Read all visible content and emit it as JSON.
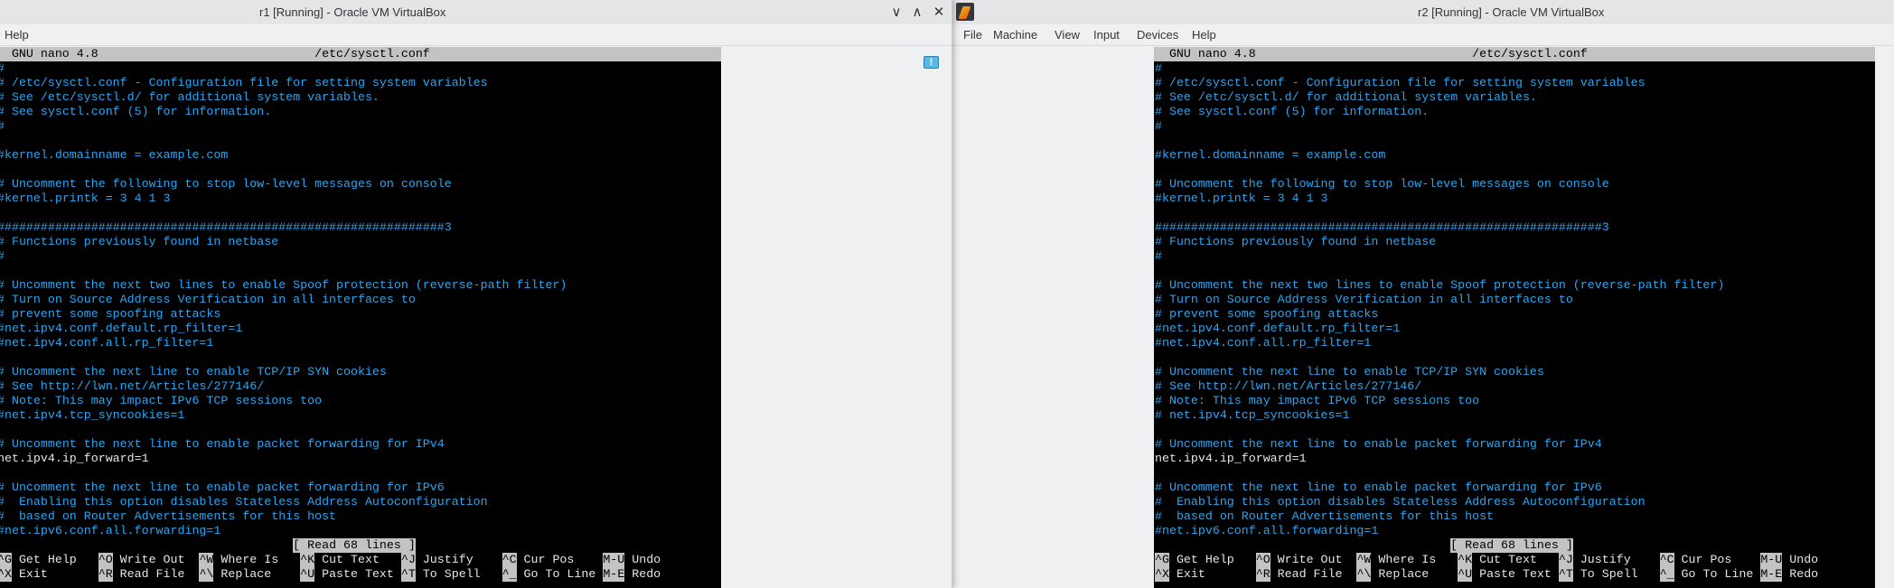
{
  "windows": [
    {
      "title": "r1 [Running] - Oracle VM VirtualBox",
      "menu": [
        "Help"
      ],
      "controls": {
        "minimize": "∨",
        "maximize": "∧",
        "close": "✕"
      },
      "nano": {
        "header_left": "GNU nano 4.8",
        "header_file": "/etc/sysctl.conf",
        "lines": [
          "#",
          "# /etc/sysctl.conf - Configuration file for setting system variables",
          "# See /etc/sysctl.d/ for additional system variables.",
          "# See sysctl.conf (5) for information.",
          "#",
          "",
          "#kernel.domainname = example.com",
          "",
          "# Uncomment the following to stop low-level messages on console",
          "#kernel.printk = 3 4 1 3",
          "",
          "##############################################################3",
          "# Functions previously found in netbase",
          "#",
          "",
          "# Uncomment the next two lines to enable Spoof protection (reverse-path filter)",
          "# Turn on Source Address Verification in all interfaces to",
          "# prevent some spoofing attacks",
          "#net.ipv4.conf.default.rp_filter=1",
          "#net.ipv4.conf.all.rp_filter=1",
          "",
          "# Uncomment the next line to enable TCP/IP SYN cookies",
          "# See http://lwn.net/Articles/277146/",
          "# Note: This may impact IPv6 TCP sessions too",
          "#net.ipv4.tcp_syncookies=1",
          "",
          "# Uncomment the next line to enable packet forwarding for IPv4",
          "net.ipv4.ip_forward=1",
          "",
          "# Uncomment the next line to enable packet forwarding for IPv6",
          "#  Enabling this option disables Stateless Address Autoconfiguration",
          "#  based on Router Advertisements for this host",
          "#net.ipv6.conf.all.forwarding=1"
        ],
        "status": "[ Read 68 lines ]",
        "shortcuts": [
          [
            {
              "key": "^G",
              "label": "Get Help"
            },
            {
              "key": "^O",
              "label": "Write Out"
            },
            {
              "key": "^W",
              "label": "Where Is"
            },
            {
              "key": "^K",
              "label": "Cut Text"
            },
            {
              "key": "^J",
              "label": "Justify"
            },
            {
              "key": "^C",
              "label": "Cur Pos"
            },
            {
              "key": "M-U",
              "label": "Undo"
            }
          ],
          [
            {
              "key": "^X",
              "label": "Exit"
            },
            {
              "key": "^R",
              "label": "Read File"
            },
            {
              "key": "^\\",
              "label": "Replace"
            },
            {
              "key": "^U",
              "label": "Paste Text"
            },
            {
              "key": "^T",
              "label": "To Spell"
            },
            {
              "key": "^_",
              "label": "Go To Line"
            },
            {
              "key": "M-E",
              "label": "Redo"
            }
          ]
        ]
      }
    },
    {
      "title": "r2 [Running] - Oracle VM VirtualBox",
      "menu": [
        "File",
        "Machine",
        "View",
        "Input",
        "Devices",
        "Help"
      ],
      "nano": {
        "header_left": "GNU nano 4.8",
        "header_file": "/etc/sysctl.conf",
        "lines": [
          "#",
          "# /etc/sysctl.conf - Configuration file for setting system variables",
          "# See /etc/sysctl.d/ for additional system variables.",
          "# See sysctl.conf (5) for information.",
          "#",
          "",
          "#kernel.domainname = example.com",
          "",
          "# Uncomment the following to stop low-level messages on console",
          "#kernel.printk = 3 4 1 3",
          "",
          "##############################################################3",
          "# Functions previously found in netbase",
          "#",
          "",
          "# Uncomment the next two lines to enable Spoof protection (reverse-path filter)",
          "# Turn on Source Address Verification in all interfaces to",
          "# prevent some spoofing attacks",
          "#net.ipv4.conf.default.rp_filter=1",
          "#net.ipv4.conf.all.rp_filter=1",
          "",
          "# Uncomment the next line to enable TCP/IP SYN cookies",
          "# See http://lwn.net/Articles/277146/",
          "# Note: This may impact IPv6 TCP sessions too",
          "# net.ipv4.tcp_syncookies=1",
          "",
          "# Uncomment the next line to enable packet forwarding for IPv4",
          "net.ipv4.ip_forward=1",
          "",
          "# Uncomment the next line to enable packet forwarding for IPv6",
          "#  Enabling this option disables Stateless Address Autoconfiguration",
          "#  based on Router Advertisements for this host",
          "#net.ipv6.conf.all.forwarding=1"
        ],
        "status": "[ Read 68 lines ]",
        "shortcuts": [
          [
            {
              "key": "^G",
              "label": "Get Help"
            },
            {
              "key": "^O",
              "label": "Write Out"
            },
            {
              "key": "^W",
              "label": "Where Is"
            },
            {
              "key": "^K",
              "label": "Cut Text"
            },
            {
              "key": "^J",
              "label": "Justify"
            },
            {
              "key": "^C",
              "label": "Cur Pos"
            },
            {
              "key": "M-U",
              "label": "Undo"
            }
          ],
          [
            {
              "key": "^X",
              "label": "Exit"
            },
            {
              "key": "^R",
              "label": "Read File"
            },
            {
              "key": "^\\",
              "label": "Replace"
            },
            {
              "key": "^U",
              "label": "Paste Text"
            },
            {
              "key": "^T",
              "label": "To Spell"
            },
            {
              "key": "^_",
              "label": "Go To Line"
            },
            {
              "key": "M-E",
              "label": "Redo"
            }
          ]
        ]
      }
    }
  ],
  "colors": {
    "comment": "#2aa6f0",
    "text": "#e6e6e6",
    "bar": "#c3c3c3",
    "chrome": "#eff0f1"
  }
}
